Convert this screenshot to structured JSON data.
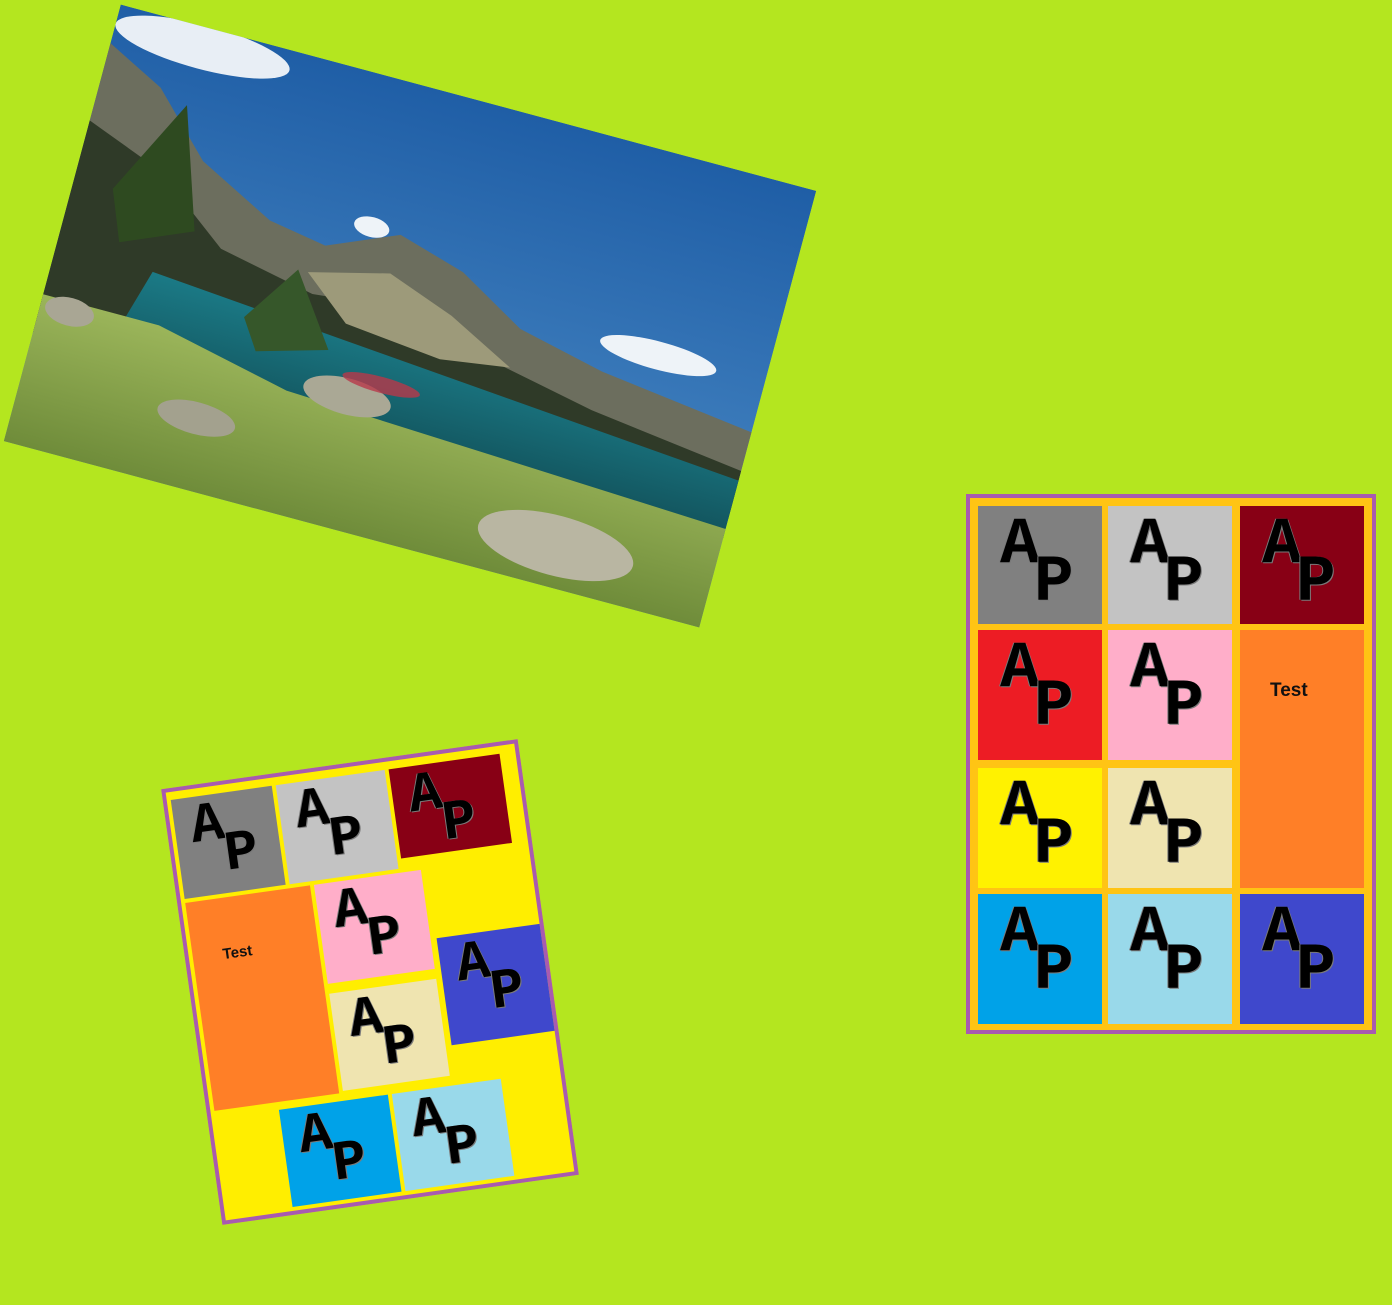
{
  "background_color": "#b4e61f",
  "photo": {
    "alt": "mountain-lake-landscape",
    "colors": {
      "sky": "#2a64a8",
      "water": "#1f6d78",
      "grass": "#8aa64a",
      "mountain": "#5b6150"
    }
  },
  "cards": {
    "right": {
      "cells": [
        {
          "monogram": [
            "A",
            "P"
          ],
          "color": "#808080"
        },
        {
          "monogram": [
            "A",
            "P"
          ],
          "color": "#c3c3c3"
        },
        {
          "monogram": [
            "A",
            "P"
          ],
          "color": "#880015"
        },
        {
          "monogram": [
            "A",
            "P"
          ],
          "color": "#ed1c24"
        },
        {
          "monogram": [
            "A",
            "P"
          ],
          "color": "#ffaec9"
        },
        {
          "label": "Test",
          "color": "#ff7f27"
        },
        {
          "monogram": [
            "A",
            "P"
          ],
          "color": "#fff200"
        },
        {
          "monogram": [
            "A",
            "P"
          ],
          "color": "#efe4b0"
        },
        {
          "monogram": [
            "A",
            "P"
          ],
          "color": "#00a2e8"
        },
        {
          "monogram": [
            "A",
            "P"
          ],
          "color": "#99d9ea"
        },
        {
          "monogram": [
            "A",
            "P"
          ],
          "color": "#3f48cc"
        }
      ]
    },
    "left": {
      "cells": [
        {
          "monogram": [
            "A",
            "P"
          ],
          "color": "#808080"
        },
        {
          "monogram": [
            "A",
            "P"
          ],
          "color": "#c3c3c3"
        },
        {
          "monogram": [
            "A",
            "P"
          ],
          "color": "#880015"
        },
        {
          "label": "Test",
          "color": "#ff7f27"
        },
        {
          "monogram": [
            "A",
            "P"
          ],
          "color": "#ffaec9"
        },
        {
          "monogram": [
            "A",
            "P"
          ],
          "color": "#efe4b0"
        },
        {
          "monogram": [
            "A",
            "P"
          ],
          "color": "#3f48cc"
        },
        {
          "monogram": [
            "A",
            "P"
          ],
          "color": "#00a2e8"
        },
        {
          "monogram": [
            "A",
            "P"
          ],
          "color": "#99d9ea"
        }
      ]
    }
  }
}
